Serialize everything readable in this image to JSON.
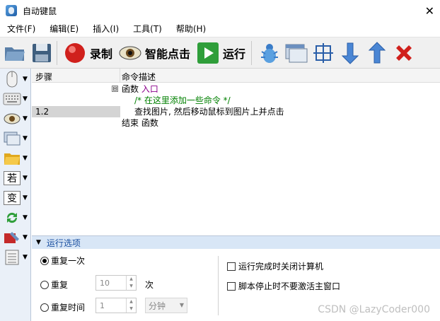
{
  "window": {
    "title": "自动键鼠",
    "close_glyph": "✕"
  },
  "menu": [
    {
      "label": "文件(F)"
    },
    {
      "label": "编辑(E)"
    },
    {
      "label": "插入(I)"
    },
    {
      "label": "工具(T)"
    },
    {
      "label": "帮助(H)"
    }
  ],
  "toolbar": {
    "record_label": "录制",
    "smart_click_label": "智能点击",
    "run_label": "运行",
    "icons": [
      "open-folder-icon",
      "save-icon",
      "record-icon",
      "eye-icon",
      "run-icon",
      "bug-icon",
      "window-icon",
      "crosshair-icon",
      "arrow-down-icon",
      "arrow-up-icon",
      "delete-icon"
    ]
  },
  "leftbar": {
    "if_label": "若",
    "var_label": "变",
    "icons": [
      "mouse-icon",
      "keyboard-icon",
      "eye-icon",
      "window-icon",
      "folder-icon",
      "if-icon",
      "variable-icon",
      "loop-icon",
      "tools-icon",
      "list-icon"
    ]
  },
  "grid": {
    "headers": {
      "step": "步骤",
      "command": "命令描述"
    },
    "tree_toggle": "⊟",
    "rows": [
      {
        "step": "",
        "cmd_kw": "函数",
        "cmd_name": "入口",
        "type": "func"
      },
      {
        "step": "",
        "cmd_comment": "/* 在这里添加一些命令 */",
        "type": "comment"
      },
      {
        "step": "1.2",
        "cmd_text": "查找图片, 然后移动鼠标到图片上并点击",
        "type": "cmd",
        "selected": true
      },
      {
        "step": "",
        "cmd_kw": "结束",
        "cmd_name": "函数",
        "type": "end"
      }
    ]
  },
  "options": {
    "header": "运行选项",
    "repeat_once": "重复一次",
    "repeat": "重复",
    "repeat_value": "10",
    "repeat_unit": "次",
    "repeat_time": "重复时间",
    "time_value": "1",
    "time_unit": "分钟",
    "shutdown_label": "运行完成时关闭计算机",
    "no_activate_label": "脚本停止时不要激活主窗口"
  },
  "watermark": "CSDN @LazyCoder000"
}
